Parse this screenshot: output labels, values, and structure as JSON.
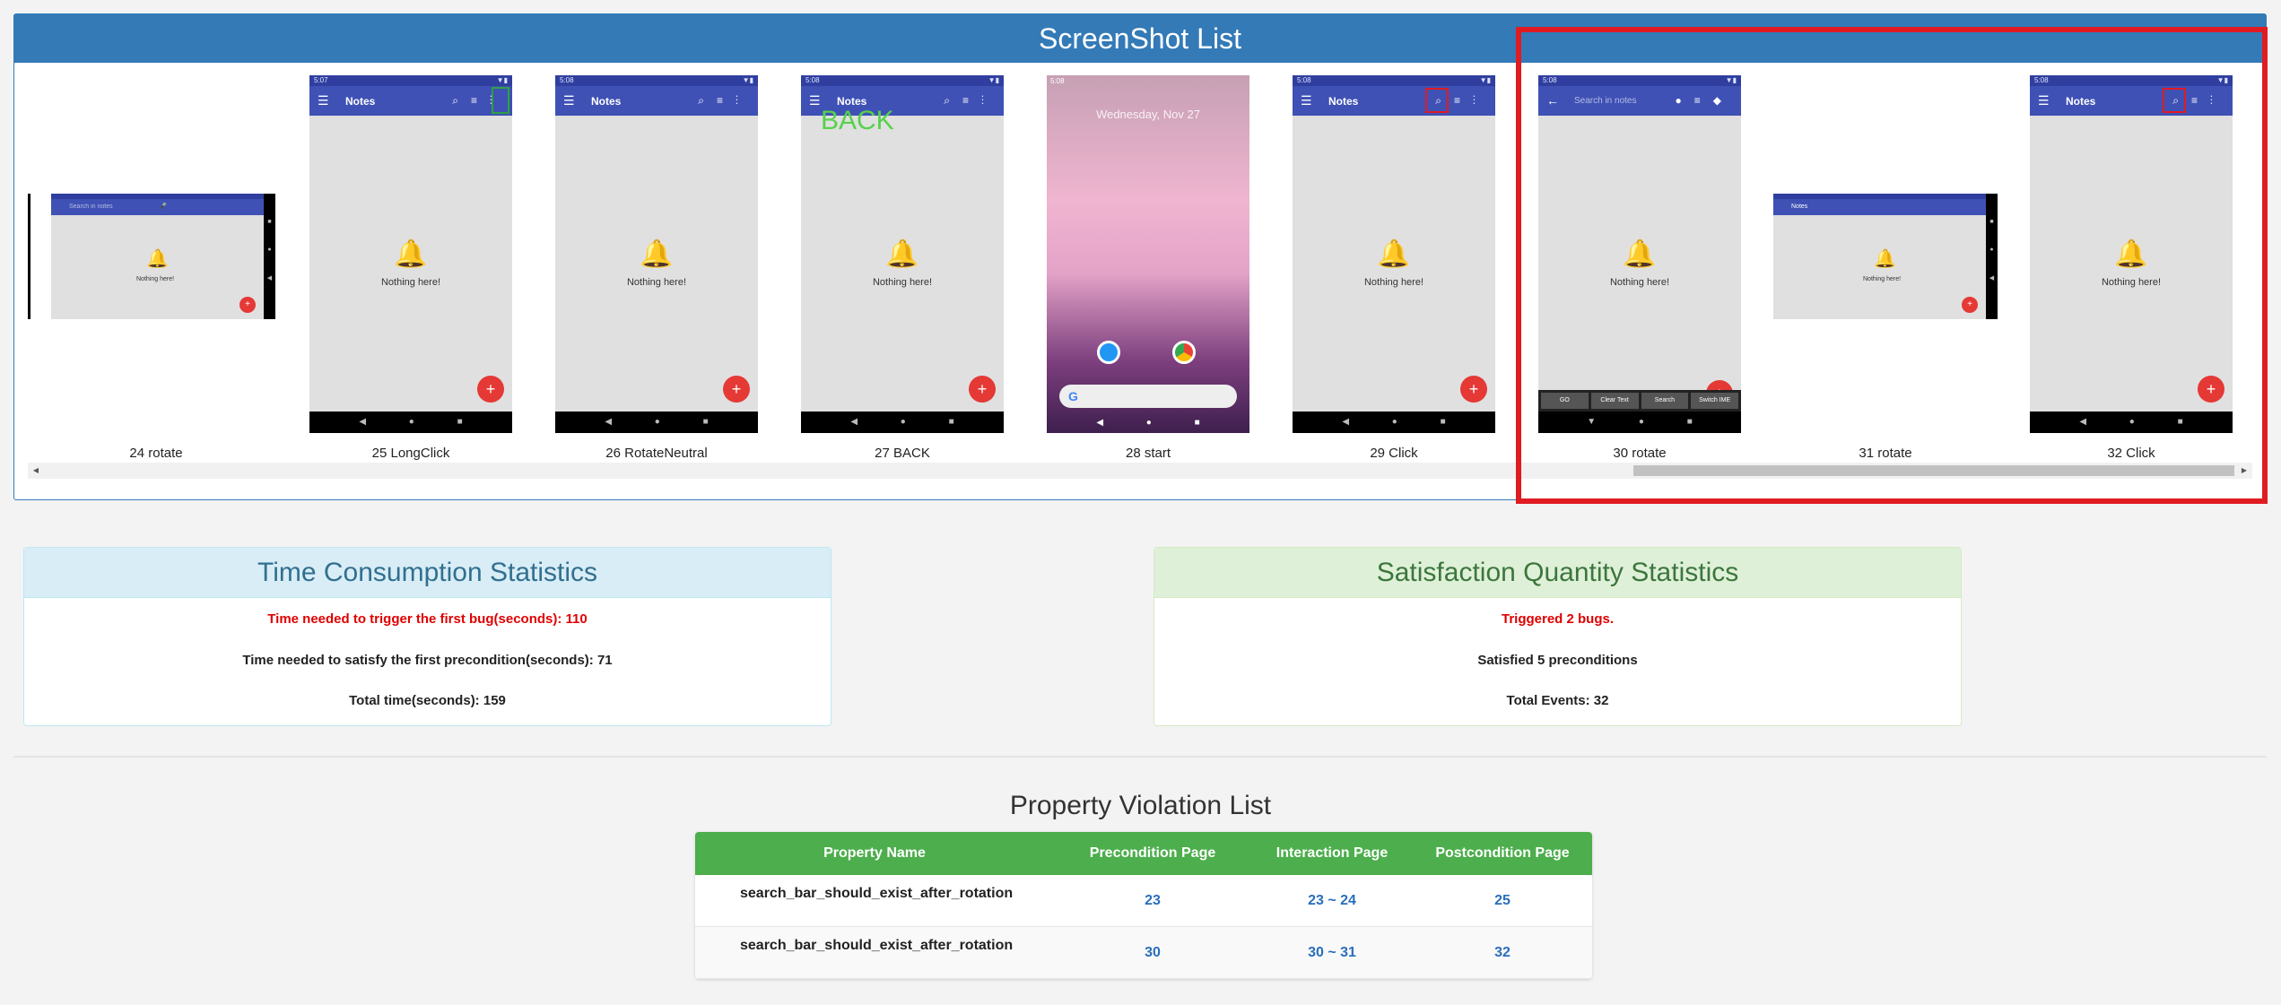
{
  "screenshot_list": {
    "title": "ScreenShot List",
    "items": [
      {
        "caption": "24 rotate",
        "kind": "landscape-search"
      },
      {
        "caption": "25 LongClick",
        "kind": "notes",
        "highlight": "more-icon",
        "highlight_color": "#2ea043"
      },
      {
        "caption": "26 RotateNeutral",
        "kind": "notes"
      },
      {
        "caption": "27 BACK",
        "kind": "notes",
        "overlay_text": "BACK"
      },
      {
        "caption": "28 start",
        "kind": "home",
        "home_date": "Wednesday, Nov 27"
      },
      {
        "caption": "29 Click",
        "kind": "notes",
        "highlight": "search-icon",
        "highlight_color": "#e01b22"
      },
      {
        "caption": "30 rotate",
        "kind": "search-keyboard"
      },
      {
        "caption": "31 rotate",
        "kind": "landscape-notes"
      },
      {
        "caption": "32 Click",
        "kind": "notes",
        "highlight": "search-icon",
        "highlight_color": "#e01b22"
      }
    ],
    "phone": {
      "status_time": [
        "5:07",
        "5:08"
      ],
      "app_title": "Notes",
      "search_placeholder": "Search in notes",
      "empty_text": "Nothing here!",
      "fab_symbol": "+",
      "keyboard_keys": [
        "GO",
        "Clear Text",
        "Search",
        "Switch IME"
      ]
    },
    "highlight_color": "#e01b22"
  },
  "time_stats": {
    "title": "Time Consumption Statistics",
    "first_bug": "Time needed to trigger the first bug(seconds): 110",
    "first_precondition": "Time needed to satisfy the first precondition(seconds): 71",
    "total_time": "Total time(seconds): 159"
  },
  "satisfaction_stats": {
    "title": "Satisfaction Quantity Statistics",
    "bugs": "Triggered 2 bugs.",
    "preconditions": "Satisfied 5 preconditions",
    "events": "Total Events: 32"
  },
  "violations": {
    "title": "Property Violation List",
    "columns": [
      "Property Name",
      "Precondition Page",
      "Interaction Page",
      "Postcondition Page"
    ],
    "rows": [
      {
        "name": "search_bar_should_exist_after_rotation",
        "pre": "23",
        "interaction": "23 ~ 24",
        "post": "25"
      },
      {
        "name": "search_bar_should_exist_after_rotation",
        "pre": "30",
        "interaction": "30 ~ 31",
        "post": "32"
      }
    ]
  },
  "colors": {
    "header_blue": "#337ab7",
    "error_red": "#e00000",
    "table_green": "#4cae4c"
  }
}
